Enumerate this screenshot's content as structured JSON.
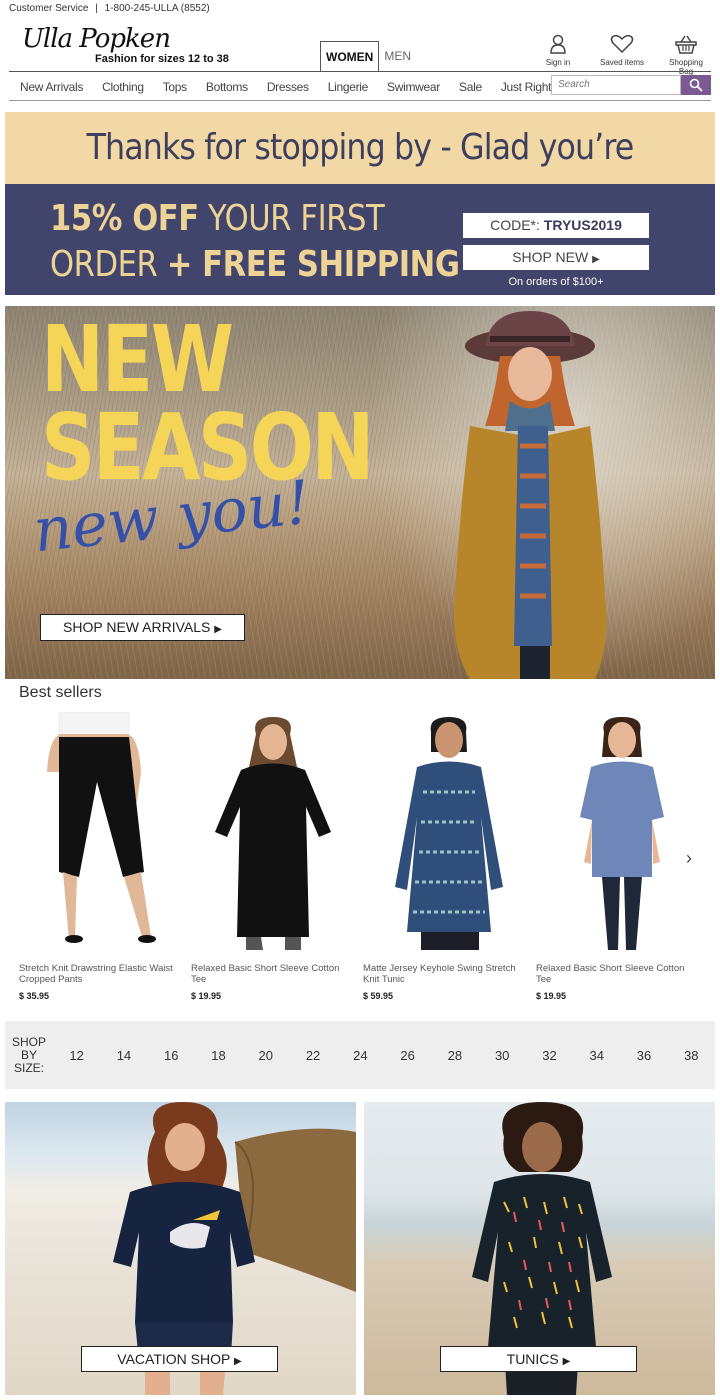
{
  "topbar": {
    "service": "Customer Service",
    "sep": "|",
    "phone": "1-800-245-ULLA (8552)"
  },
  "brand": {
    "logo": "Ulla Popken",
    "tagline": "Fashion for sizes 12 to 38"
  },
  "gender_tabs": [
    {
      "label": "WOMEN",
      "active": true
    },
    {
      "label": "MEN",
      "active": false
    }
  ],
  "header_icons": {
    "sign_in": "Sign in",
    "saved": "Saved items",
    "bag": "Shopping Bag"
  },
  "nav": [
    "New Arrivals",
    "Clothing",
    "Tops",
    "Bottoms",
    "Dresses",
    "Lingerie",
    "Swimwear",
    "Sale",
    "Just Right"
  ],
  "search": {
    "placeholder": "Search"
  },
  "promo": {
    "headline": "Thanks for stopping by - Glad you’re here!",
    "offer_bold1": "15% OFF",
    "offer_rest1": " YOUR FIRST",
    "offer_rest2": "ORDER ",
    "offer_bold2": "+ FREE SHIPPING",
    "code_label": "CODE*: ",
    "code": "TRYUS2019",
    "shop_new": "SHOP NEW",
    "note": "On orders of $100+"
  },
  "hero": {
    "line1": "NEW",
    "line2": "SEASON",
    "line3": "new you!",
    "cta": "SHOP NEW ARRIVALS"
  },
  "best_sellers": {
    "title": "Best sellers",
    "items": [
      {
        "name": "Stretch Knit Drawstring Elastic Waist Cropped Pants",
        "price": "$ 35.95"
      },
      {
        "name": "Relaxed Basic Short Sleeve Cotton Tee",
        "price": "$ 19.95"
      },
      {
        "name": "Matte Jersey Keyhole Swing Stretch Knit Tunic",
        "price": "$ 59.95"
      },
      {
        "name": "Relaxed Basic Short Sleeve Cotton Tee",
        "price": "$ 19.95"
      }
    ]
  },
  "size_bar": {
    "label_lines": [
      "SHOP",
      "BY",
      "SIZE:"
    ],
    "sizes": [
      "12",
      "14",
      "16",
      "18",
      "20",
      "22",
      "24",
      "26",
      "28",
      "30",
      "32",
      "34",
      "36",
      "38"
    ]
  },
  "tiles": {
    "left_cta": "VACATION SHOP",
    "right_cta": "TUNICS"
  },
  "colors": {
    "accent": "#7b5a93",
    "promo_cream": "#f1d8a4",
    "promo_navy": "#42456b",
    "hero_yellow": "#f5d557",
    "hero_blue": "#3550a8"
  }
}
